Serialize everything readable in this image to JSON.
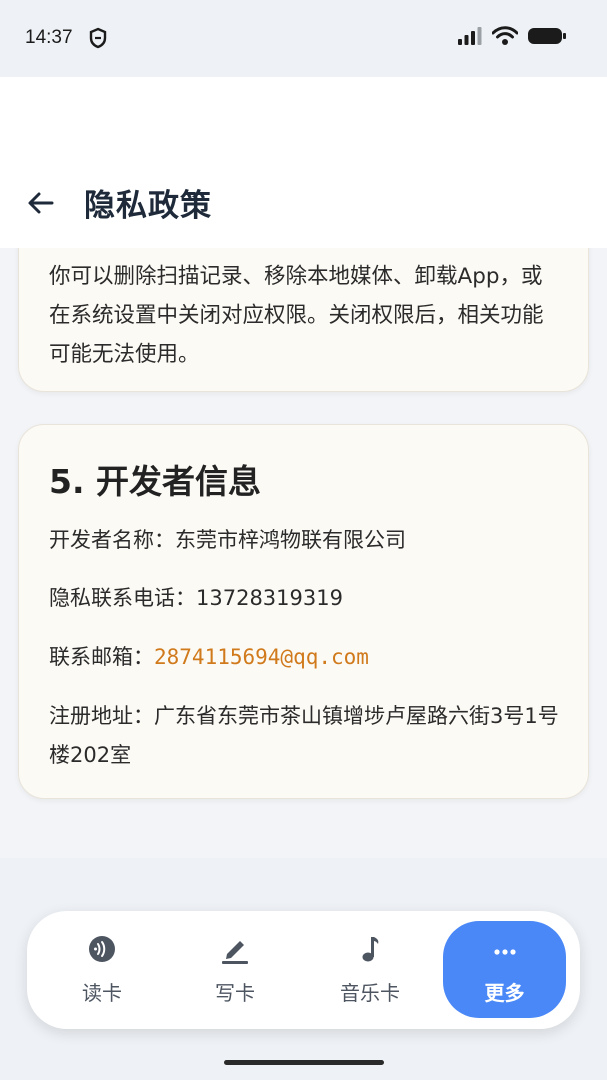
{
  "status_bar": {
    "time": "14:37"
  },
  "header": {
    "title": "隐私政策"
  },
  "prev_section": {
    "text": "你可以删除扫描记录、移除本地媒体、卸载App，或在系统设置中关闭对应权限。关闭权限后，相关功能可能无法使用。"
  },
  "developer_section": {
    "title": "5. 开发者信息",
    "name_label": "开发者名称：",
    "name_value": "东莞市梓鸿物联有限公司",
    "phone_label": "隐私联系电话：",
    "phone_value": "13728319319",
    "email_label": "联系邮箱：",
    "email_value": "2874115694@qq.com",
    "address_label": "注册地址：",
    "address_value": "广东省东莞市茶山镇增埗卢屋路六街3号1号楼202室"
  },
  "bottom_nav": {
    "items": [
      {
        "label": "读卡",
        "icon": "nfc-read-icon"
      },
      {
        "label": "写卡",
        "icon": "pencil-write-icon"
      },
      {
        "label": "音乐卡",
        "icon": "music-note-icon"
      },
      {
        "label": "更多",
        "icon": "more-dots-icon"
      }
    ],
    "active_index": 3
  },
  "colors": {
    "accent": "#4a88f7",
    "email_link": "#d07a1c",
    "card_bg": "#fcfaf5"
  }
}
